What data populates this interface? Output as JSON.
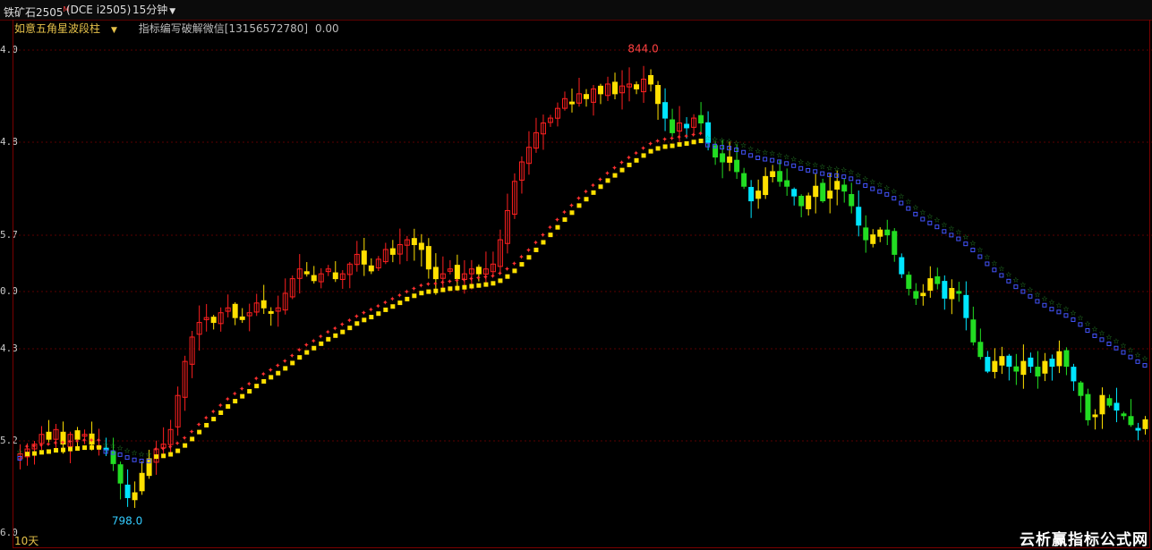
{
  "header": {
    "symbol": "铁矿石2505",
    "symbol_sup": "M",
    "code": "(DCE i2505)",
    "timeframe": "15分钟",
    "dropdown_icon": "chevron-down-icon"
  },
  "indicator": {
    "name": "如意五角星波段柱",
    "desc": "指标编写破解微信[13156572780]",
    "value": "0.00"
  },
  "colors": {
    "bull": "#ff2020",
    "bear_cyan": "#00e5ff",
    "bear_green": "#22dd22",
    "band_yellow": "#ffe000",
    "star_red": "#ff3030",
    "star_green": "#2e9e2e",
    "star_blue": "#4455ff"
  },
  "y_axis": {
    "labels": [
      "4.0",
      "4.8",
      "5.7",
      "0.0",
      "4.3",
      "5.2",
      "6.0"
    ]
  },
  "chart_data": {
    "type": "candlestick",
    "high_label": "844.0",
    "low_label": "798.0",
    "ylim": [
      795.5,
      846.5
    ],
    "closes": [
      804.0,
      804.5,
      805.0,
      806.0,
      805.5,
      806.5,
      805.0,
      806.0,
      805.5,
      806.0,
      805.0,
      804.8,
      804.5,
      803.0,
      801.0,
      799.5,
      800.0,
      802.0,
      803.5,
      804.5,
      805.0,
      806.5,
      810.0,
      813.5,
      816.0,
      817.5,
      818.0,
      817.5,
      818.5,
      819.0,
      818.0,
      817.8,
      818.5,
      819.5,
      819.0,
      818.5,
      819.0,
      820.5,
      822.0,
      823.0,
      822.5,
      821.8,
      822.5,
      823.0,
      822.0,
      822.5,
      823.5,
      824.5,
      823.5,
      822.8,
      824.0,
      825.0,
      824.5,
      825.5,
      826.0,
      825.5,
      825.0,
      823.0,
      822.0,
      822.5,
      823.0,
      822.0,
      822.5,
      823.0,
      822.5,
      823.0,
      823.5,
      826.0,
      829.0,
      832.0,
      834.0,
      835.5,
      837.0,
      838.0,
      838.5,
      839.5,
      840.5,
      840.0,
      841.0,
      840.5,
      841.5,
      841.0,
      842.0,
      841.0,
      841.8,
      842.0,
      841.5,
      842.5,
      842.0,
      840.0,
      838.5,
      837.0,
      838.0,
      837.5,
      838.5,
      838.0,
      836.0,
      834.5,
      834.0,
      834.5,
      833.0,
      831.5,
      830.0,
      831.0,
      832.5,
      833.0,
      832.0,
      831.5,
      830.5,
      829.5,
      830.5,
      831.5,
      830.0,
      831.0,
      832.0,
      831.0,
      829.5,
      827.5,
      826.0,
      826.5,
      827.0,
      826.5,
      824.5,
      822.5,
      821.0,
      820.0,
      820.5,
      822.0,
      821.5,
      820.0,
      821.0,
      820.5,
      818.0,
      815.5,
      814.0,
      812.5,
      813.5,
      814.0,
      813.0,
      812.5,
      813.5,
      813.0,
      812.0,
      813.5,
      813.0,
      814.5,
      813.0,
      811.5,
      810.0,
      807.5,
      808.0,
      810.0,
      809.0,
      808.5,
      808.0,
      807.0,
      806.5,
      807.5
    ],
    "candle_count": 155
  },
  "period_label": "10天",
  "watermark": "云析赢指标公式网"
}
